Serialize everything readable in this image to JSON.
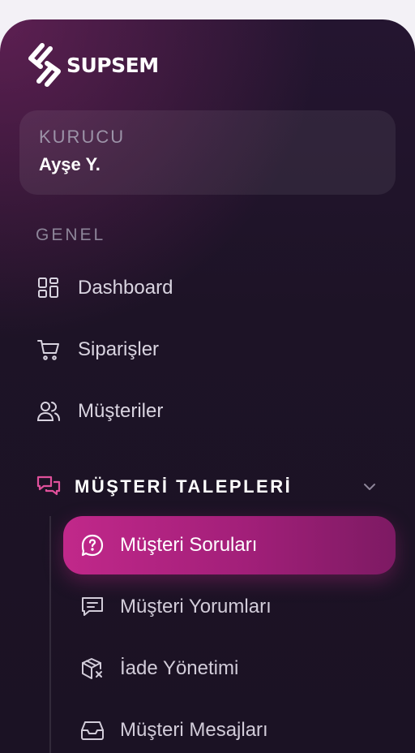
{
  "brand": {
    "name": "SUPSEM"
  },
  "user": {
    "role": "KURUCU",
    "name": "Ayşe Y."
  },
  "section": {
    "title": "GENEL"
  },
  "nav": [
    {
      "label": "Dashboard",
      "icon": "grid-icon"
    },
    {
      "label": "Siparişler",
      "icon": "cart-icon"
    },
    {
      "label": "Müşteriler",
      "icon": "users-icon"
    }
  ],
  "group": {
    "label": "MÜŞTERİ TALEPLERİ",
    "icon": "chat-bubbles-icon",
    "accent": "#e0509b",
    "expanded": true,
    "items": [
      {
        "label": "Müşteri Soruları",
        "icon": "question-bubble-icon",
        "active": true
      },
      {
        "label": "Müşteri Yorumları",
        "icon": "comment-icon",
        "active": false
      },
      {
        "label": "İade Yönetimi",
        "icon": "return-box-icon",
        "active": false
      },
      {
        "label": "Müşteri Mesajları",
        "icon": "inbox-icon",
        "active": false
      }
    ]
  },
  "colors": {
    "active_gradient_start": "#c1288a",
    "active_gradient_end": "#7d1a63",
    "panel_bg": "#1d1326"
  }
}
